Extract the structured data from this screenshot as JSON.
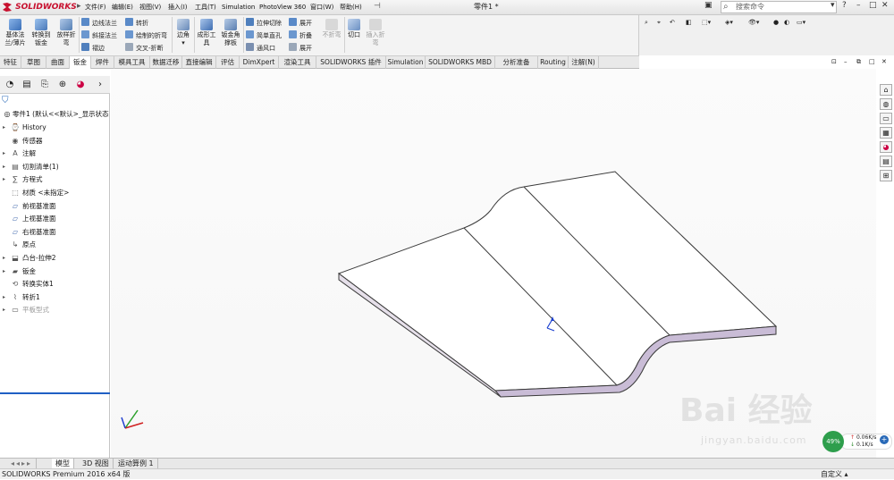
{
  "app": {
    "brand": "SOLIDWORKS",
    "doc_title": "零件1 *"
  },
  "menu": [
    "文件(F)",
    "编辑(E)",
    "视图(V)",
    "插入(I)",
    "工具(T)",
    "Simulation",
    "PhotoView 360",
    "窗口(W)",
    "帮助(H)"
  ],
  "search": {
    "placeholder": "搜索命令"
  },
  "ribbon": {
    "large": [
      {
        "label": "基体法兰/薄片",
        "icon": "base-flange-icon"
      },
      {
        "label": "转换到钣金",
        "icon": "convert-sheetmetal-icon"
      },
      {
        "label": "放样折弯",
        "icon": "lofted-bend-icon"
      },
      {
        "label": "边角",
        "icon": "corners-icon"
      },
      {
        "label": "成形工具",
        "icon": "forming-tool-icon"
      },
      {
        "label": "钣金角撑板",
        "icon": "gusset-icon"
      },
      {
        "label": "切口",
        "icon": "rip-icon"
      },
      {
        "label": "插入折弯",
        "icon": "insert-bends-icon"
      }
    ],
    "small_col1": [
      "边线法兰",
      "斜接法兰",
      "褶边"
    ],
    "small_col2": [
      "转折",
      "绘制的折弯",
      "交叉-折断"
    ],
    "small_col3": [
      "拉伸切除",
      "简单直孔",
      "通风口"
    ],
    "small_col4": [
      "展开",
      "折叠",
      "展开"
    ],
    "unfold_disabled": "不折弯"
  },
  "tabs": [
    "特征",
    "草图",
    "曲面",
    "钣金",
    "焊件",
    "模具工具",
    "数据迁移",
    "直接编辑",
    "评估",
    "DimXpert",
    "渲染工具",
    "SOLIDWORKS 插件",
    "Simulation",
    "SOLIDWORKS MBD",
    "分析准备",
    "Routing",
    "注解(N)"
  ],
  "tree": {
    "root": "零件1 (默认<<默认>_显示状态",
    "items": [
      {
        "label": "History",
        "icon": "history-icon",
        "exp": true
      },
      {
        "label": "传感器",
        "icon": "sensor-icon",
        "exp": false
      },
      {
        "label": "注解",
        "icon": "annotation-icon",
        "exp": true
      },
      {
        "label": "切割清单(1)",
        "icon": "cutlist-icon",
        "exp": true
      },
      {
        "label": "方程式",
        "icon": "equation-icon",
        "exp": true
      },
      {
        "label": "材质 <未指定>",
        "icon": "material-icon",
        "exp": false
      },
      {
        "label": "前视基准面",
        "icon": "plane-icon",
        "exp": false
      },
      {
        "label": "上视基准面",
        "icon": "plane-icon",
        "exp": false
      },
      {
        "label": "右视基准面",
        "icon": "plane-icon",
        "exp": false
      },
      {
        "label": "原点",
        "icon": "origin-icon",
        "exp": false
      },
      {
        "label": "凸台-拉伸2",
        "icon": "boss-extrude-icon",
        "exp": true
      },
      {
        "label": "钣金",
        "icon": "sheetmetal-icon",
        "exp": true
      },
      {
        "label": "转换实体1",
        "icon": "convert-entities-icon",
        "exp": false
      },
      {
        "label": "转折1",
        "icon": "jog-icon",
        "exp": true
      },
      {
        "label": "平板型式",
        "icon": "flat-pattern-icon",
        "exp": true
      }
    ]
  },
  "bottom_tabs": [
    "模型",
    "3D 视图",
    "运动算例 1"
  ],
  "status": {
    "left": "SOLIDWORKS Premium 2016 x64 版",
    "right": "自定义"
  },
  "speed": {
    "percent": "49%",
    "up": "0.06K/s",
    "down": "0.1K/s"
  },
  "watermark": {
    "text": "Bai 经验",
    "url": "jingyan.baidu.com"
  }
}
